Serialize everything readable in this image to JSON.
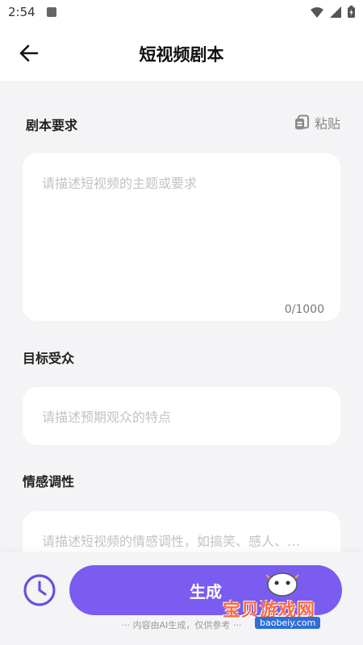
{
  "status_bar": {
    "time": "2:54"
  },
  "header": {
    "title": "短视频剧本"
  },
  "script_requirements": {
    "label": "剧本要求",
    "paste_label": "粘贴",
    "placeholder": "请描述短视频的主题或要求",
    "counter": "0/1000"
  },
  "target_audience": {
    "label": "目标受众",
    "placeholder": "请描述预期观众的特点"
  },
  "emotional_tone": {
    "label": "情感调性",
    "placeholder": "请描述短视频的情感调性，如搞笑、感人、…"
  },
  "footer": {
    "generate_label": "生成",
    "disclaimer": "··· 内容由AI生成，仅供参考 ···"
  },
  "watermark": {
    "text": "宝贝游戏网",
    "url": "baobeiy.com"
  },
  "colors": {
    "accent": "#7a5cf0",
    "background": "#f4f4f6"
  }
}
